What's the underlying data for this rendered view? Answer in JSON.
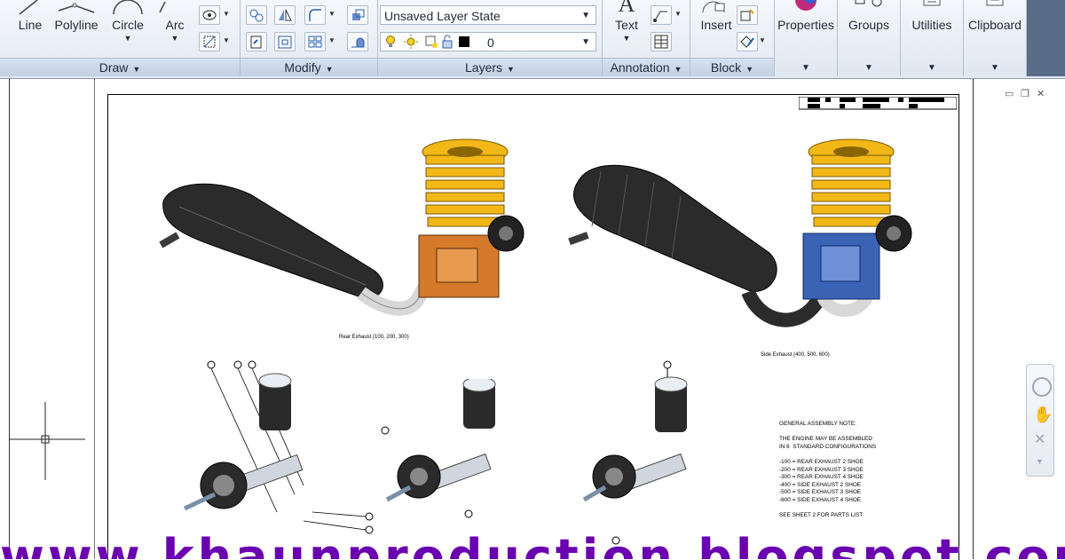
{
  "ribbon": {
    "draw": {
      "title": "Draw",
      "buttons": {
        "line": "Line",
        "polyline": "Polyline",
        "circle": "Circle",
        "arc": "Arc"
      }
    },
    "modify": {
      "title": "Modify"
    },
    "layers": {
      "title": "Layers",
      "layer_state": "Unsaved Layer State",
      "current_layer": "0"
    },
    "annotation": {
      "title": "Annotation",
      "text_button": "Text"
    },
    "block": {
      "title": "Block",
      "insert_button": "Insert"
    },
    "properties": "Properties",
    "groups": "Groups",
    "utilities": "Utilities",
    "clipboard": "Clipboard"
  },
  "drawing": {
    "caption_left": "Rear Exhaust (100, 200, 300)",
    "caption_right": "Side Exhaust (400, 500, 600)",
    "notes": [
      "GENERAL ASSEMBLY NOTE:",
      "",
      "THE ENGINE MAY BE ASSEMBLED",
      "IN 6  STANDARD CONFIGURATIONS",
      "",
      "-100 = REAR EXHAUST 2 SHOE",
      "-200 = REAR EXHAUST 3 SHOE",
      "-300 = REAR EXHAUST 4 SHOE",
      "-400 = SIDE EXHAUST 2 SHOE",
      "-500 = SIDE EXHAUST 3 SHOE",
      "-600 = SIDE EXHAUST 4 SHOE",
      "",
      "SEE SHEET 2 FOR PARTS LIST"
    ]
  },
  "watermark": "www.khaunproduction.blogspot.com",
  "colors": {
    "ribbon_bg": "#e2e9f2",
    "panel_title_bg": "#c6d3e4",
    "fins": "#f2b818",
    "crank_left": "#d47a2a",
    "crank_right": "#3b63b5",
    "watermark": "#6a00b0"
  },
  "icons": [
    "line-icon",
    "polyline-icon",
    "circle-icon",
    "arc-icon",
    "move-icon",
    "mirror-icon",
    "fillet-icon",
    "array-icon",
    "lightbulb-icon",
    "sun-icon",
    "lock-icon",
    "text-icon",
    "insert-icon",
    "properties-icon",
    "groups-icon",
    "utilities-icon",
    "clipboard-icon",
    "pan-icon",
    "zoom-icon",
    "steering-wheel-icon"
  ]
}
